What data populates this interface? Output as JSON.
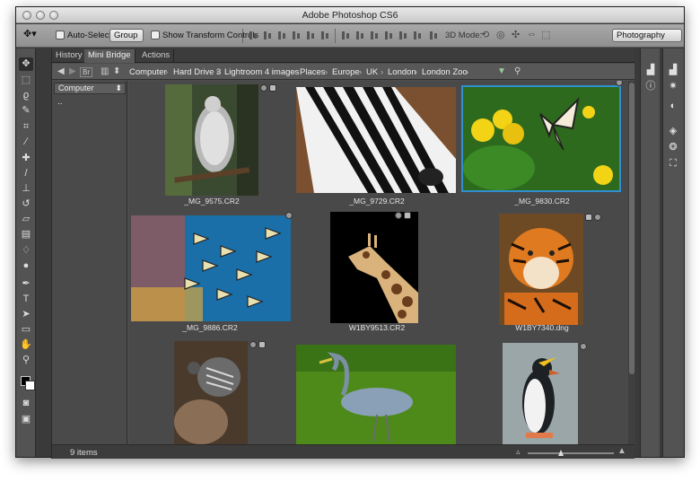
{
  "window": {
    "title": "Adobe Photoshop CS6"
  },
  "options_bar": {
    "auto_select_label": "Auto-Select:",
    "auto_select_value": "Group",
    "show_transform_label": "Show Transform Controls",
    "mode_3d_label": "3D Mode:",
    "workspace": "Photography"
  },
  "panel": {
    "tabs": [
      "History",
      "Mini Bridge",
      "Actions"
    ],
    "active_tab": "Mini Bridge",
    "breadcrumbs": [
      "Computer",
      "Hard Drive 3",
      "Lightroom 4 images",
      "Places",
      "Europe",
      "UK",
      "London",
      "London Zoo"
    ],
    "sidebar_dropdown": "Computer",
    "sidebar_dots": "..",
    "status_count": "9 items",
    "thumbnails": [
      {
        "name": "_MG_9575.CR2",
        "subject": "vulture"
      },
      {
        "name": "_MG_9729.CR2",
        "subject": "zebra"
      },
      {
        "name": "_MG_9830.CR2",
        "subject": "butterfly",
        "selected": true
      },
      {
        "name": "_MG_9886.CR2",
        "subject": "fish"
      },
      {
        "name": "W1BY9513.CR2",
        "subject": "giraffe"
      },
      {
        "name": "W1BY7340.dng",
        "subject": "tiger"
      },
      {
        "name": "",
        "subject": "bird-rock"
      },
      {
        "name": "",
        "subject": "heron"
      },
      {
        "name": "",
        "subject": "penguin"
      }
    ]
  },
  "colors": {
    "accent": "#2f8fcf",
    "panel_bg": "#494949",
    "foreground": "#000000",
    "background": "#ffffff"
  }
}
